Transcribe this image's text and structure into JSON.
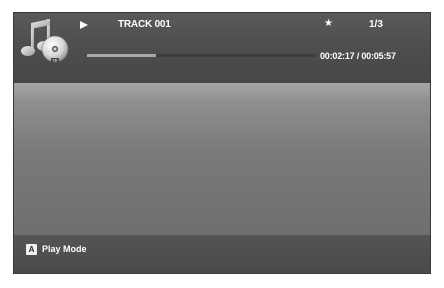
{
  "header": {
    "music_cd_icon": "music-cd-icon",
    "play_icon": "play-icon",
    "track_title": "TRACK 001",
    "star_icon": "★",
    "track_counter": "1/3",
    "progress_fraction": 0.3,
    "time_readout": "00:02:17 / 00:05:57"
  },
  "footer": {
    "button_key": "A",
    "action_label": "Play Mode"
  },
  "colors": {
    "header_bg": "#4e4e4e",
    "content_bg": "#8a8a8a",
    "footer_bg": "#4b4b4b",
    "text": "#ffffff",
    "progress_fill": "#a9a9a9"
  }
}
